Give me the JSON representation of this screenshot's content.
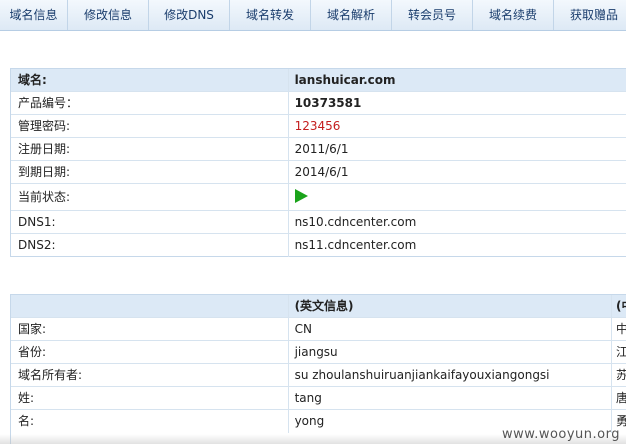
{
  "tabs": [
    "域名信息",
    "修改信息",
    "修改DNS",
    "域名转发",
    "域名解析",
    "转会员号",
    "域名续费",
    "获取赠品"
  ],
  "domain_info": {
    "header": {
      "label": "域名:",
      "value": "lanshuicar.com"
    },
    "rows": [
      {
        "label": "产品编号：",
        "value": "10373581"
      },
      {
        "label": "管理密码:",
        "value": "123456"
      },
      {
        "label": "注册日期:",
        "value": "2011/6/1"
      },
      {
        "label": "到期日期:",
        "value": "2014/6/1"
      },
      {
        "label": "当前状态:",
        "value": ""
      },
      {
        "label": "DNS1:",
        "value": "ns10.cdncenter.com"
      },
      {
        "label": "DNS2:",
        "value": "ns11.cdncenter.com"
      }
    ],
    "status_icon": "play-icon",
    "status_color": "#1aa31a",
    "password_color": "#c41e1e"
  },
  "owner_info": {
    "header": {
      "label": "",
      "english": "(英文信息)",
      "chinese": "(中"
    },
    "rows": [
      {
        "label": "国家:",
        "english": "CN",
        "chinese": "中"
      },
      {
        "label": "省份:",
        "english": "jiangsu",
        "chinese": "江"
      },
      {
        "label": "域名所有者:",
        "english": "su zhoulanshuiruanjiankaifayouxiangongsi",
        "chinese": "苏"
      },
      {
        "label": "姓:",
        "english": "tang",
        "chinese": "唐"
      },
      {
        "label": "名:",
        "english": "yong",
        "chinese": "勇"
      }
    ]
  },
  "watermark": "www.wooyun.org"
}
